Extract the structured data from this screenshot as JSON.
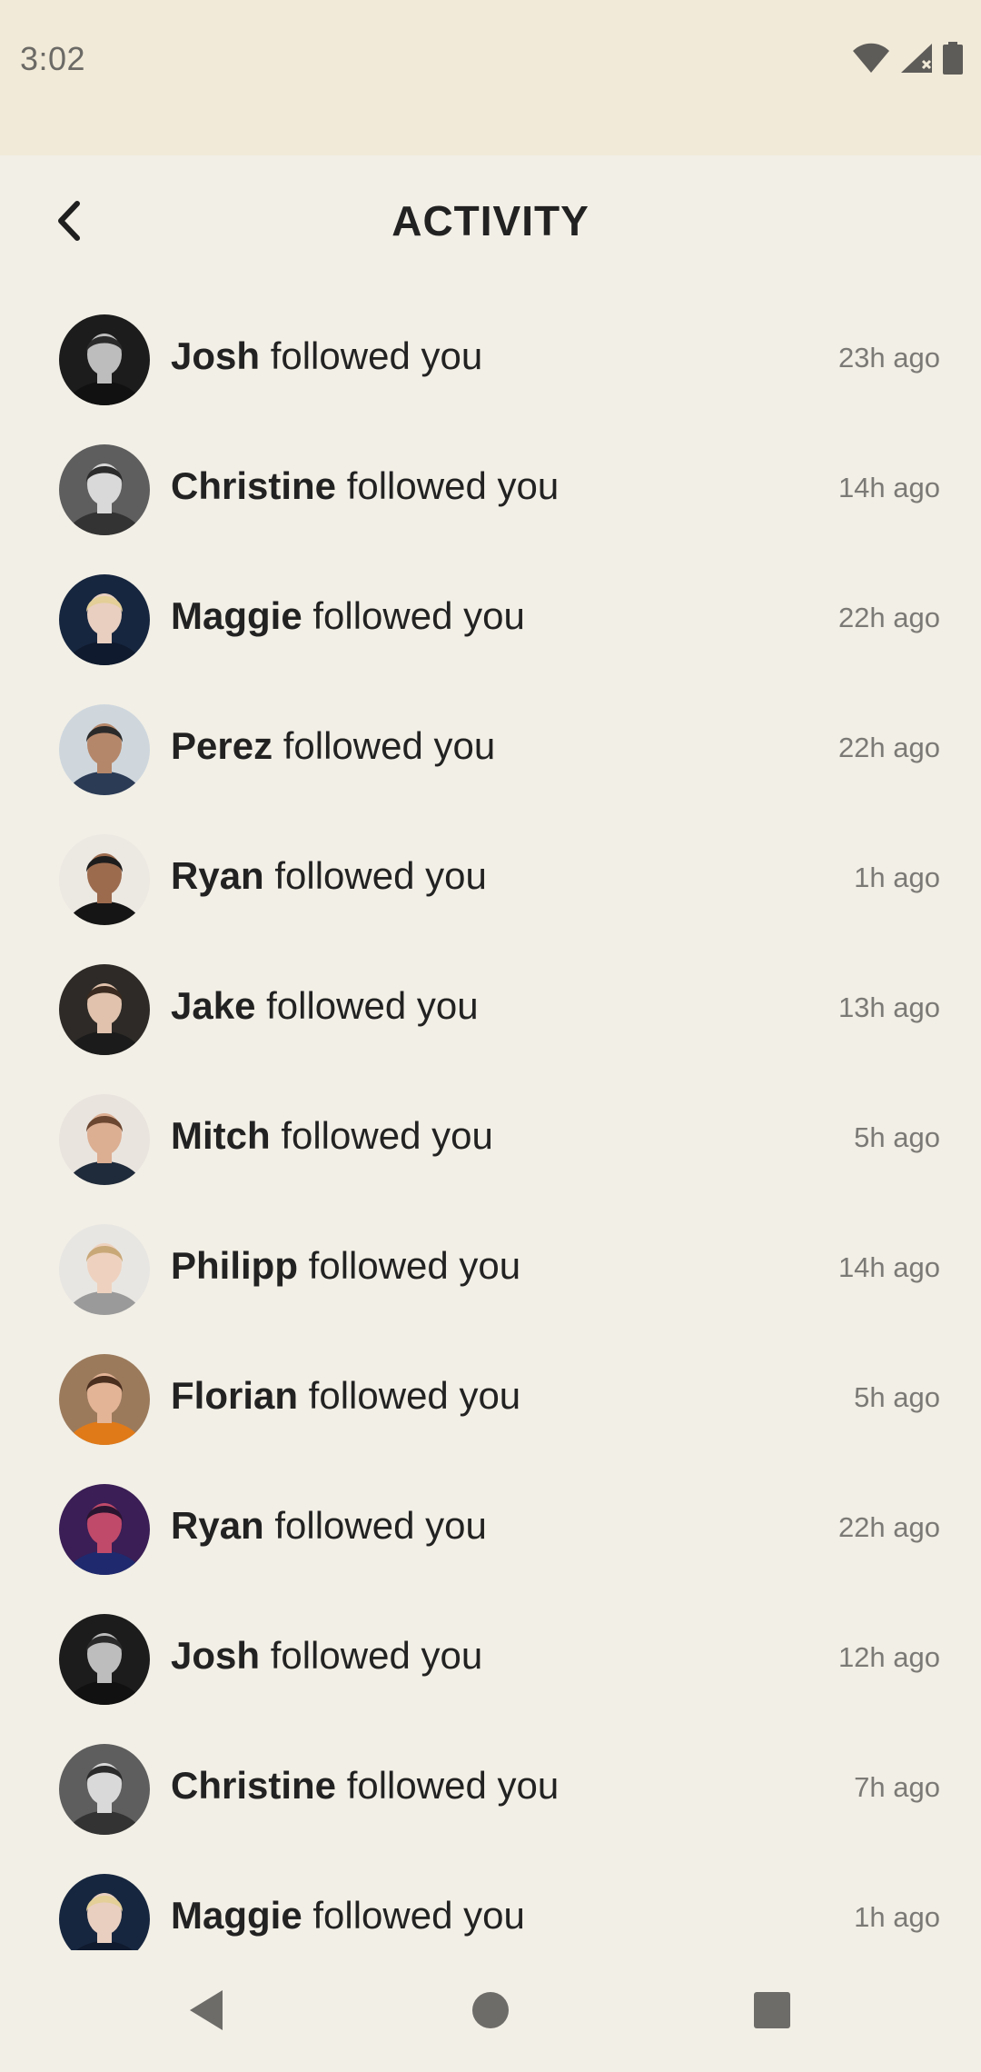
{
  "status_bar": {
    "time": "3:02",
    "icons": [
      "wifi-icon",
      "signal-icon",
      "battery-icon"
    ]
  },
  "header": {
    "back_icon": "chevron-left-icon",
    "title": "ACTIVITY"
  },
  "activity": {
    "action_text": " followed you",
    "items": [
      {
        "name": "Josh",
        "time": "23h ago",
        "avatar": {
          "bg": "#1c1c1c",
          "skin": "#bdbdbd",
          "hair": "#2a2a2a",
          "shirt": "#111111"
        }
      },
      {
        "name": "Christine",
        "time": "14h ago",
        "avatar": {
          "bg": "#5e5e5e",
          "skin": "#d9d9d9",
          "hair": "#2b2b2b",
          "shirt": "#333333"
        }
      },
      {
        "name": "Maggie",
        "time": "22h ago",
        "avatar": {
          "bg": "#17263f",
          "skin": "#e8cfc0",
          "hair": "#e3cf97",
          "shirt": "#0f1a2e"
        }
      },
      {
        "name": "Perez",
        "time": "22h ago",
        "avatar": {
          "bg": "#cfd7dd",
          "skin": "#b5876a",
          "hair": "#2a2a2a",
          "shirt": "#2b3b55"
        }
      },
      {
        "name": "Ryan",
        "time": "1h ago",
        "avatar": {
          "bg": "#ece8e2",
          "skin": "#9c6b4e",
          "hair": "#1d1d1d",
          "shirt": "#151515"
        }
      },
      {
        "name": "Jake",
        "time": "13h ago",
        "avatar": {
          "bg": "#2d2a27",
          "skin": "#e0c2ad",
          "hair": "#3a2a1f",
          "shirt": "#1b1b1b"
        }
      },
      {
        "name": "Mitch",
        "time": "5h ago",
        "avatar": {
          "bg": "#e9e4de",
          "skin": "#dcae92",
          "hair": "#6b4630",
          "shirt": "#1f2a3a"
        }
      },
      {
        "name": "Philipp",
        "time": "14h ago",
        "avatar": {
          "bg": "#e8e6e2",
          "skin": "#eed2bf",
          "hair": "#c9a878",
          "shirt": "#9a9a9a"
        }
      },
      {
        "name": "Florian",
        "time": "5h ago",
        "avatar": {
          "bg": "#9b7a5c",
          "skin": "#e3b496",
          "hair": "#4a2f1f",
          "shirt": "#e07a18"
        }
      },
      {
        "name": "Ryan",
        "time": "22h ago",
        "avatar": {
          "bg": "#3a1e55",
          "skin": "#c04a6a",
          "hair": "#2a1530",
          "shirt": "#1f2a6e"
        }
      },
      {
        "name": "Josh",
        "time": "12h ago",
        "avatar": {
          "bg": "#1c1c1c",
          "skin": "#bdbdbd",
          "hair": "#2a2a2a",
          "shirt": "#111111"
        }
      },
      {
        "name": "Christine",
        "time": "7h ago",
        "avatar": {
          "bg": "#5e5e5e",
          "skin": "#d9d9d9",
          "hair": "#2b2b2b",
          "shirt": "#333333"
        }
      },
      {
        "name": "Maggie",
        "time": "1h ago",
        "avatar": {
          "bg": "#17263f",
          "skin": "#e8cfc0",
          "hair": "#e3cf97",
          "shirt": "#0f1a2e"
        }
      }
    ]
  },
  "nav_bar": {
    "icons": [
      "back-triangle-icon",
      "home-circle-icon",
      "recents-square-icon"
    ]
  },
  "colors": {
    "background": "#f2efe6",
    "status_bar": "#f1ead8",
    "text": "#222222",
    "secondary_text": "#7c7a76"
  }
}
